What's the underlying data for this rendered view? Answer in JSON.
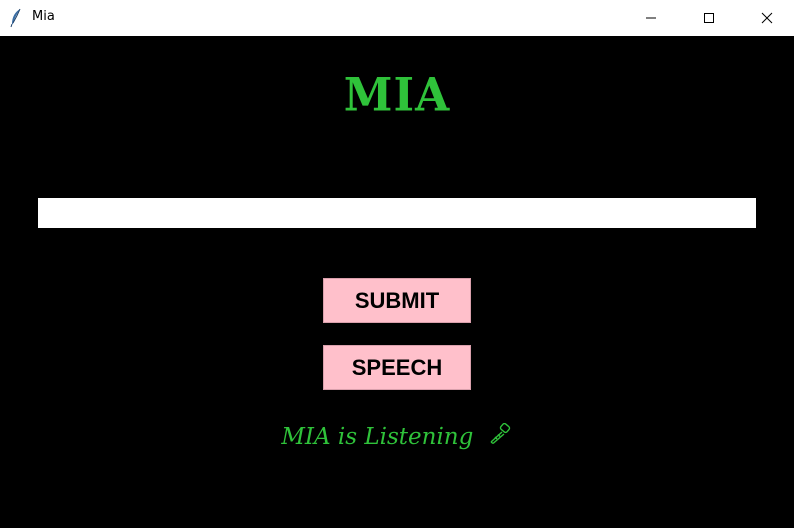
{
  "window": {
    "title": "Mia",
    "icon": "feather-icon",
    "controls": [
      "minimize-icon",
      "maximize-icon",
      "close-icon"
    ]
  },
  "main": {
    "title": "MIA",
    "input": {
      "value": "",
      "placeholder": ""
    },
    "submit_label": "SUBMIT",
    "speech_label": "SPEECH",
    "status_text": "MIA is Listening",
    "status_icon": "microphone-icon"
  },
  "colors": {
    "accent": "#2fc23a",
    "button_bg": "#ffc0cb",
    "background": "#000000",
    "titlebar": "#ffffff"
  }
}
